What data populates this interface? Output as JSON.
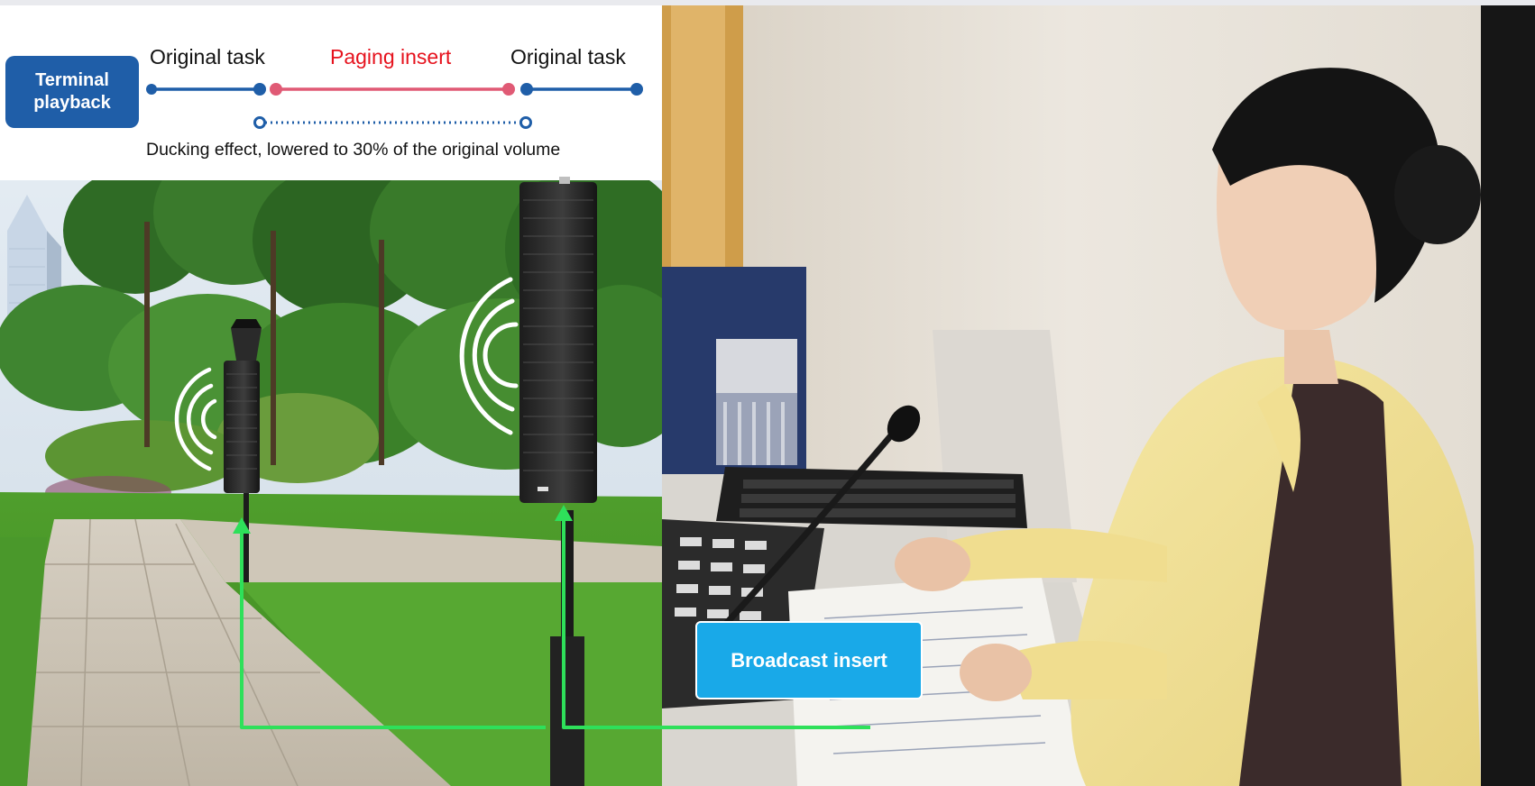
{
  "timeline": {
    "terminal_label": "Terminal playback",
    "segment_1_label": "Original task",
    "segment_2_label": "Paging insert",
    "segment_3_label": "Original task",
    "ducking_caption": "Ducking effect, lowered to 30% of the original volume"
  },
  "broadcast_button_label": "Broadcast insert",
  "colors": {
    "terminal_box": "#1f5ea8",
    "original_task_line": "#1f5ea8",
    "paging_line": "#e05a75",
    "paging_text": "#e6121d",
    "broadcast_box": "#19a9e8",
    "connector_arrow": "#2ee05a"
  }
}
